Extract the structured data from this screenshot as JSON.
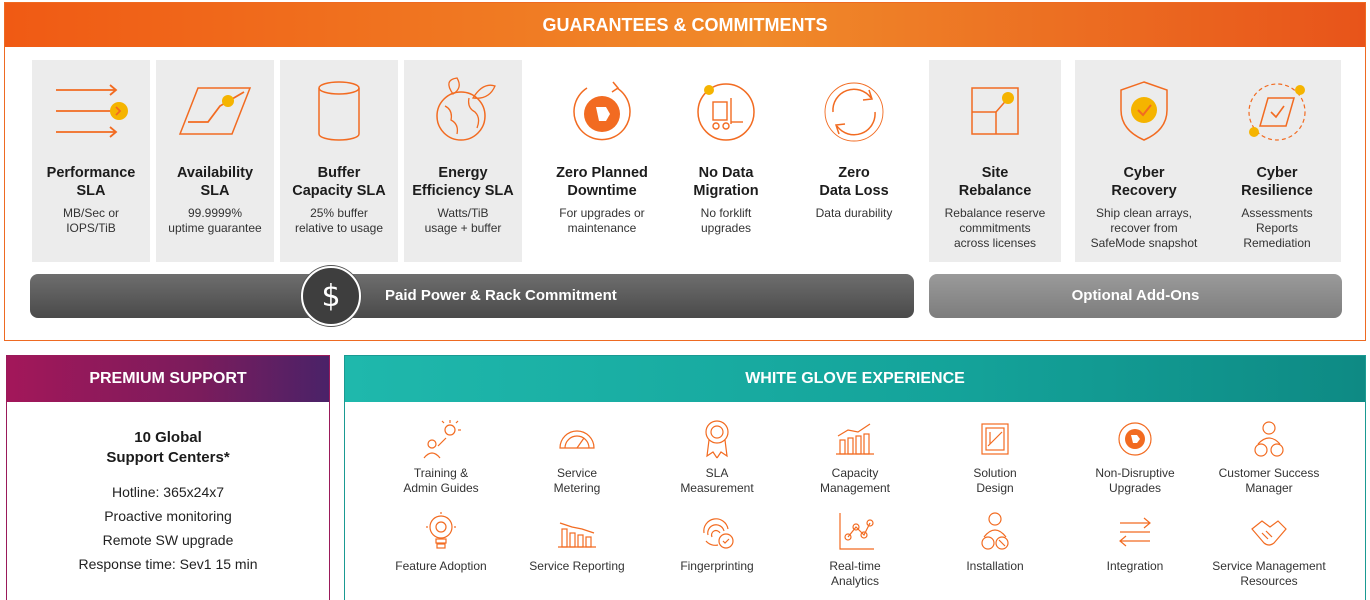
{
  "top": {
    "header": "GUARANTEES & COMMITMENTS",
    "cards": [
      {
        "title": "Performance\nSLA",
        "desc": "MB/Sec or\nIOPS/TiB",
        "icon": "performance-arrows-icon"
      },
      {
        "title": "Availability\nSLA",
        "desc": "99.9999%\nuptime guarantee",
        "icon": "availability-chart-icon"
      },
      {
        "title": "Buffer\nCapacity SLA",
        "desc": "25% buffer\nrelative to usage",
        "icon": "cylinder-icon"
      },
      {
        "title": "Energy\nEfficiency SLA",
        "desc": "Watts/TiB\nusage + buffer",
        "icon": "globe-leaf-icon"
      },
      {
        "title": "Zero Planned\nDowntime",
        "desc": "For upgrades or\nmaintenance",
        "icon": "refresh-logo-icon"
      },
      {
        "title": "No Data\nMigration",
        "desc": "No forklift\nupgrades",
        "icon": "forklift-icon"
      },
      {
        "title": "Zero\nData Loss",
        "desc": "Data durability",
        "icon": "circular-arrows-icon"
      },
      {
        "title": "Site\nRebalance",
        "desc": "Rebalance reserve\ncommitments\nacross licenses",
        "icon": "rebalance-square-icon"
      },
      {
        "title": "Cyber\nRecovery",
        "desc": "Ship clean arrays,\nrecover from\nSafeMode snapshot",
        "icon": "shield-check-icon"
      },
      {
        "title": "Cyber\nResilience",
        "desc": "Assessments\nReports\nRemediation",
        "icon": "resilience-check-icon"
      }
    ],
    "paid_bar": "Paid Power & Rack Commitment",
    "addon_bar": "Optional Add-Ons",
    "dollar_symbol": "$"
  },
  "premium": {
    "header": "PREMIUM SUPPORT",
    "title": "10 Global\nSupport Centers*",
    "lines": [
      "Hotline: 365x24x7",
      "Proactive monitoring",
      "Remote SW upgrade",
      "Response time: Sev1 15 min"
    ]
  },
  "white_glove": {
    "header": "WHITE GLOVE EXPERIENCE",
    "row1": [
      {
        "label": "Training &\nAdmin Guides",
        "icon": "training-icon"
      },
      {
        "label": "Service\nMetering",
        "icon": "gauge-icon"
      },
      {
        "label": "SLA\nMeasurement",
        "icon": "award-ribbon-icon"
      },
      {
        "label": "Capacity\nManagement",
        "icon": "bar-growth-icon"
      },
      {
        "label": "Solution\nDesign",
        "icon": "design-board-icon"
      },
      {
        "label": "Non-Disruptive\nUpgrades",
        "icon": "upgrade-logo-icon"
      },
      {
        "label": "Customer Success\nManager",
        "icon": "customer-manager-icon"
      }
    ],
    "row2": [
      {
        "label": "Feature Adoption",
        "icon": "lightbulb-gear-icon"
      },
      {
        "label": "Service Reporting",
        "icon": "report-bars-icon"
      },
      {
        "label": "Fingerprinting",
        "icon": "fingerprint-icon"
      },
      {
        "label": "Real-time\nAnalytics",
        "icon": "analytics-icon"
      },
      {
        "label": "Installation",
        "icon": "installation-icon"
      },
      {
        "label": "Integration",
        "icon": "integration-arrows-icon"
      },
      {
        "label": "Service Management\nResources",
        "icon": "handshake-icon"
      }
    ]
  },
  "colors": {
    "orange": "#f26b21",
    "magenta": "#a3175a",
    "teal": "#1fb8ac",
    "gold": "#f5b400"
  }
}
